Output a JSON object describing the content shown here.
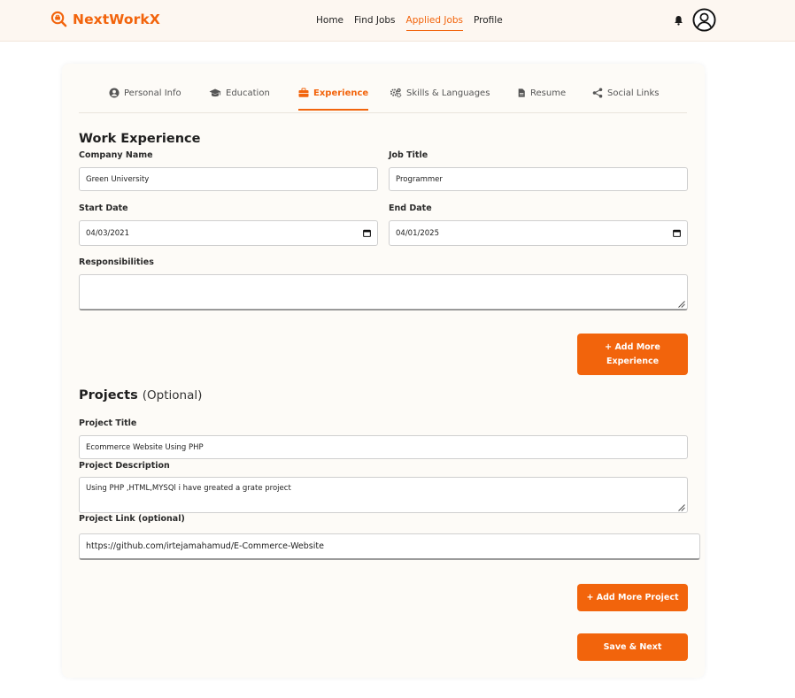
{
  "brand": {
    "name": "NextWorkX",
    "color": "#f2640c",
    "icon": "search-briefcase-icon"
  },
  "nav": {
    "links": [
      {
        "label": "Home"
      },
      {
        "label": "Find Jobs"
      },
      {
        "label": "Applied Jobs",
        "active": true
      },
      {
        "label": "Profile"
      }
    ],
    "icons": [
      "bell-icon",
      "user-avatar-icon"
    ]
  },
  "tabs": [
    {
      "label": "Personal Info",
      "icon": "user-circle-icon"
    },
    {
      "label": "Education",
      "icon": "graduation-cap-icon"
    },
    {
      "label": "Experience",
      "icon": "briefcase-icon",
      "active": true
    },
    {
      "label": "Skills & Languages",
      "icon": "gears-icon"
    },
    {
      "label": "Resume",
      "icon": "file-icon"
    },
    {
      "label": "Social Links",
      "icon": "share-icon"
    }
  ],
  "work": {
    "title": "Work Experience",
    "company_label": "Company Name",
    "company_value": "Green University",
    "job_title_label": "Job Title",
    "job_title_value": "Programmer",
    "start_label": "Start Date",
    "start_value": "04/03/2021",
    "end_label": "End Date",
    "end_value": "04/01/2025",
    "responsibilities_label": "Responsibilities",
    "responsibilities_value": "",
    "add_button": "+ Add More Experience"
  },
  "projects": {
    "title": "Projects",
    "title_suffix": "(Optional)",
    "project_title_label": "Project Title",
    "project_title_value": "Ecommerce Website Using PHP",
    "description_label": "Project Description",
    "description_value": "Using PHP ,HTML,MYSQl i have greated a grate project",
    "link_label": "Project Link (optional)",
    "link_value": "https://github.com/irtejamahamud/E-Commerce-Website",
    "add_button": "+ Add More Project"
  },
  "save_button": "Save & Next"
}
